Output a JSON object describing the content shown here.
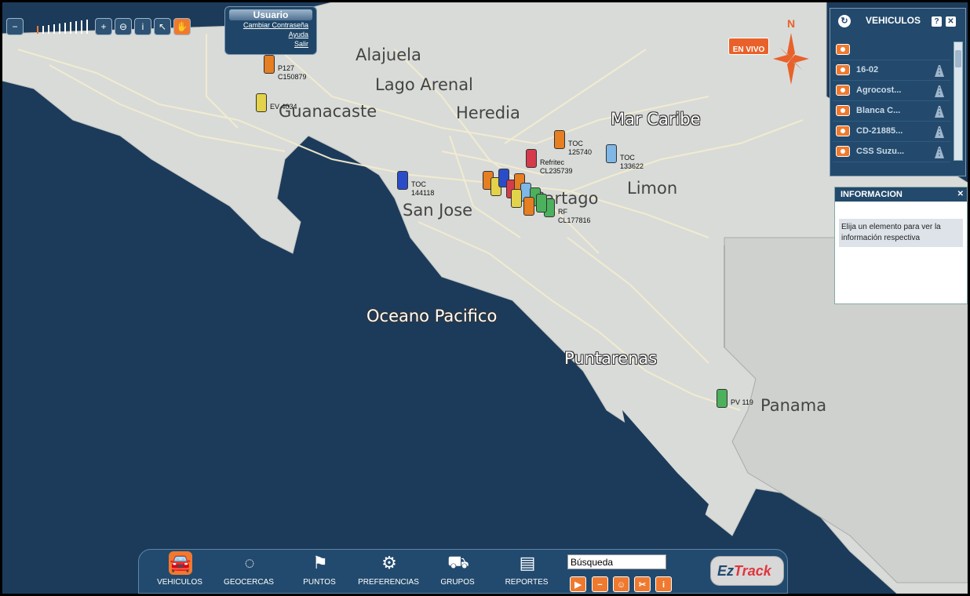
{
  "map": {
    "places": [
      {
        "name": "Alajuela",
        "style": "dark"
      },
      {
        "name": "Lago Arenal",
        "style": "dark"
      },
      {
        "name": "Heredia",
        "style": "dark"
      },
      {
        "name": "Guanacaste",
        "style": "dark"
      },
      {
        "name": "Mar Caribe",
        "style": "light"
      },
      {
        "name": "Limon",
        "style": "dark"
      },
      {
        "name": "San Jose",
        "style": "dark"
      },
      {
        "name": "Cartago",
        "style": "dark"
      },
      {
        "name": "Oceano Pacifico",
        "style": "light"
      },
      {
        "name": "Puntarenas",
        "style": "light"
      },
      {
        "name": "Panama",
        "style": "dark"
      }
    ],
    "vehicles": [
      {
        "label": "P127\nC150879",
        "color": "#e67e22"
      },
      {
        "label": "EV 4034",
        "color": "#e2d34a"
      },
      {
        "label": "TOC\n144118",
        "color": "#2b4cc9"
      },
      {
        "label": "Refritec\nCL235739",
        "color": "#d63b4b"
      },
      {
        "label": "TOC\n125740",
        "color": "#e67e22"
      },
      {
        "label": "TOC\n133622",
        "color": "#7fb7e6"
      },
      {
        "label": "RF\nCL177816",
        "color": "#4bb15c"
      },
      {
        "label": "PV 119",
        "color": "#4bb15c"
      }
    ],
    "colors": {
      "sea": "#1c3b5a",
      "land": "#d9dbd8",
      "roads": "#f3ecd0"
    }
  },
  "zoombar": {
    "icons": [
      "zoom-out-icon",
      "zoom-in-icon",
      "zoom-reset-icon",
      "info-icon",
      "select-arrow-icon",
      "pan-hand-icon"
    ]
  },
  "user": {
    "title": "Usuario",
    "change_password": "Cambiar Contraseña",
    "help": "Ayuda",
    "logout": "Salir"
  },
  "live": {
    "label": "EN VIVO"
  },
  "compass": {
    "north": "N"
  },
  "vehicles_panel": {
    "title": "VEHICULOS",
    "help": "?",
    "close": "✕",
    "items": [
      {
        "name": ""
      },
      {
        "name": "16-02"
      },
      {
        "name": "Agrocost..."
      },
      {
        "name": "Blanca C..."
      },
      {
        "name": "CD-21885..."
      },
      {
        "name": "CSS Suzu..."
      }
    ]
  },
  "info_panel": {
    "title": "INFORMACION",
    "close": "✕",
    "message": "Elija un elemento para ver la información respectiva"
  },
  "toolbar": {
    "items": [
      {
        "label": "VEHICULOS",
        "icon": "vehicle-icon"
      },
      {
        "label": "GEOCERCAS",
        "icon": "geofence-icon"
      },
      {
        "label": "PUNTOS",
        "icon": "flag-icon"
      },
      {
        "label": "PREFERENCIAS",
        "icon": "gear-icon"
      },
      {
        "label": "GRUPOS",
        "icon": "group-icon"
      },
      {
        "label": "REPORTES",
        "icon": "report-icon"
      }
    ],
    "search_value": "Búsqueda",
    "logo": "EzTrack",
    "accent": "#ef7a2f"
  }
}
